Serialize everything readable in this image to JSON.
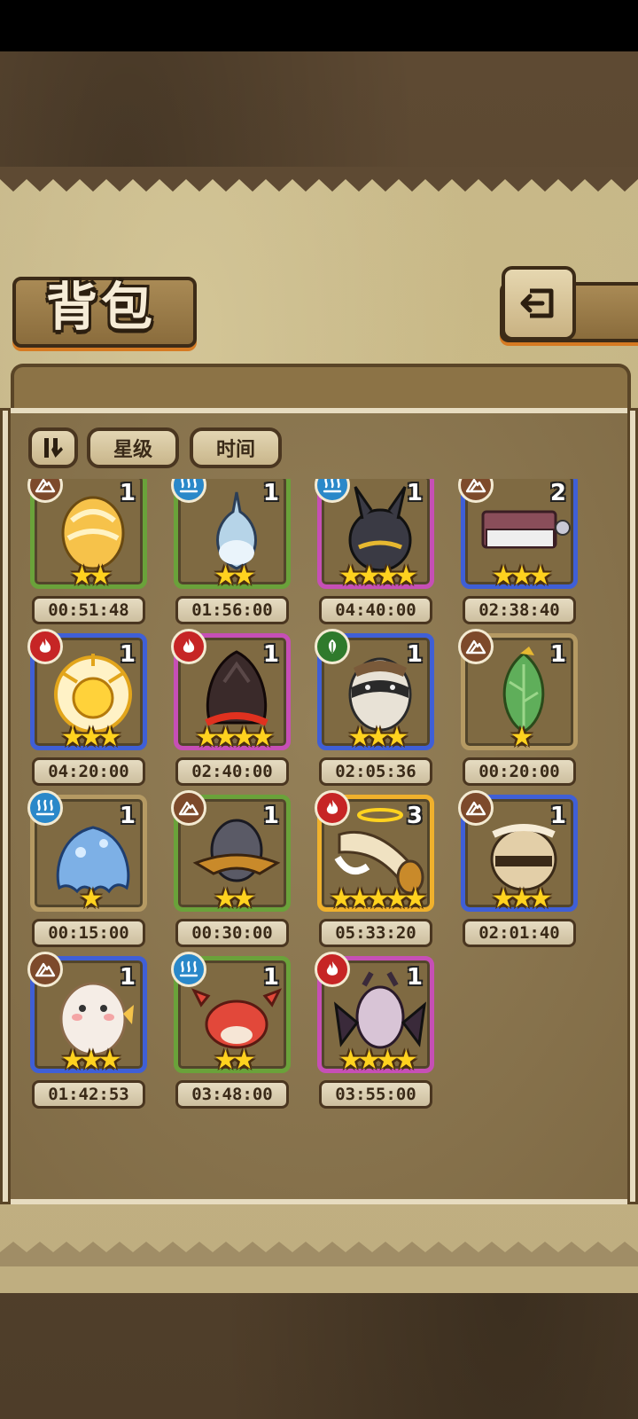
{
  "header": {
    "title": "背包"
  },
  "toolbar": {
    "sort_star_label": "星级",
    "sort_time_label": "时间"
  },
  "items": [
    {
      "element": "earth",
      "count": "1",
      "stars": "★★",
      "timer": "00:51:48",
      "rarity": "green",
      "art": "egg-gold"
    },
    {
      "element": "water",
      "count": "1",
      "stars": "★★",
      "timer": "01:56:00",
      "rarity": "green",
      "art": "egg-drop"
    },
    {
      "element": "water",
      "count": "1",
      "stars": "★★★★",
      "timer": "04:40:00",
      "rarity": "purple",
      "art": "egg-anubis"
    },
    {
      "element": "earth",
      "count": "2",
      "stars": "★★★",
      "timer": "02:38:40",
      "rarity": "blue",
      "art": "book"
    },
    {
      "element": "fire",
      "count": "1",
      "stars": "★★★",
      "timer": "04:20:00",
      "rarity": "blue",
      "art": "egg-sun"
    },
    {
      "element": "fire",
      "count": "1",
      "stars": "★★★★",
      "timer": "02:40:00",
      "rarity": "purple",
      "art": "egg-lava"
    },
    {
      "element": "wood",
      "count": "1",
      "stars": "★★★",
      "timer": "02:05:36",
      "rarity": "blue",
      "art": "egg-spiked"
    },
    {
      "element": "earth",
      "count": "1",
      "stars": "★",
      "timer": "00:20:00",
      "rarity": "tan",
      "art": "egg-leaf"
    },
    {
      "element": "water",
      "count": "1",
      "stars": "★",
      "timer": "00:15:00",
      "rarity": "tan",
      "art": "egg-slime"
    },
    {
      "element": "earth",
      "count": "1",
      "stars": "★★",
      "timer": "00:30:00",
      "rarity": "green",
      "art": "egg-hat"
    },
    {
      "element": "fire",
      "count": "3",
      "stars": "★★★★★",
      "timer": "05:33:20",
      "rarity": "gold",
      "art": "horn"
    },
    {
      "element": "earth",
      "count": "1",
      "stars": "★★★",
      "timer": "02:01:40",
      "rarity": "blue",
      "art": "egg-fur"
    },
    {
      "element": "earth",
      "count": "1",
      "stars": "★★★",
      "timer": "01:42:53",
      "rarity": "blue",
      "art": "egg-fluffy"
    },
    {
      "element": "water",
      "count": "1",
      "stars": "★★",
      "timer": "03:48:00",
      "rarity": "green",
      "art": "egg-crab"
    },
    {
      "element": "fire",
      "count": "1",
      "stars": "★★★★",
      "timer": "03:55:00",
      "rarity": "purple",
      "art": "egg-bat"
    }
  ]
}
